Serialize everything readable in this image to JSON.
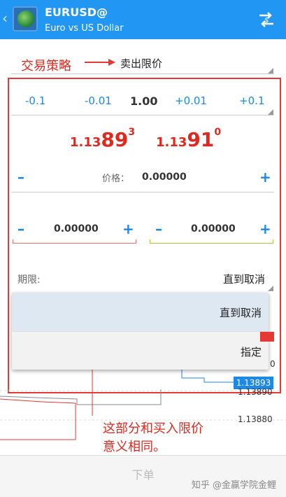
{
  "header": {
    "symbol": "EURUSD@",
    "description": "Euro vs US Dollar",
    "back_icon": "chevron-left-icon",
    "swap_icon": "swap-arrows-icon"
  },
  "strategy": {
    "annotation": "交易策略",
    "value": "卖出限价"
  },
  "steps": {
    "m01": "-0.1",
    "m001": "-0.01",
    "volume": "1.00",
    "p001": "+0.01",
    "p01": "+0.1"
  },
  "quotes": {
    "bid": {
      "prefix": "1.13",
      "big": "89",
      "sup": "3"
    },
    "ask": {
      "prefix": "1.13",
      "big": "91",
      "sup": "0"
    }
  },
  "price_field": {
    "minus": "–",
    "label": "价格：",
    "value": "0.00000",
    "plus": "+"
  },
  "sl_field": {
    "minus": "–",
    "value": "0.00000",
    "plus": "+"
  },
  "tp_field": {
    "minus": "–",
    "value": "0.00000",
    "plus": "+"
  },
  "expiry": {
    "label": "期限:",
    "value": "直到取消"
  },
  "dropdown": {
    "options": [
      "直到取消",
      "指定"
    ]
  },
  "chart": {
    "price_tag": "1.13893",
    "label1": "1.13890",
    "label2": "1.13880",
    "partial": "0"
  },
  "annotation_bottom": {
    "line1": "这部分和买入限价",
    "line2": "意义相同。"
  },
  "footer": {
    "button": "下单",
    "watermark": "知乎 @金赢学院金鲤"
  },
  "colors": {
    "header": "#2196f3",
    "accent": "#1e88e5",
    "sell": "#e0281e",
    "annotation": "#e53935"
  }
}
